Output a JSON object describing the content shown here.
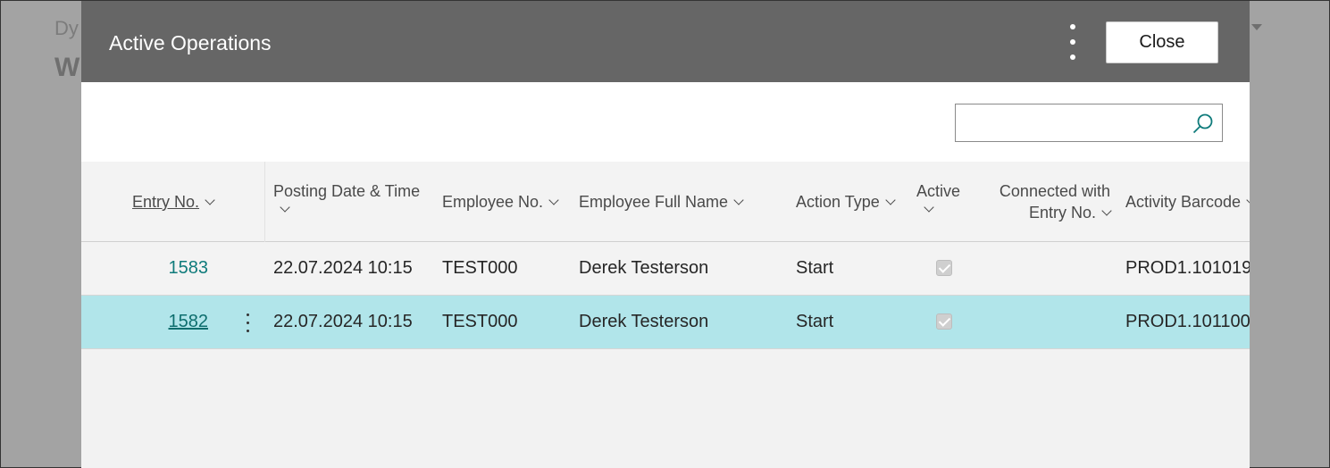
{
  "background": {
    "title_line1": "Dy",
    "title_line2": "W"
  },
  "dialog": {
    "title": "Active Operations",
    "close_label": "Close",
    "search_placeholder": ""
  },
  "columns": {
    "entry_no": "Entry No.",
    "posting_date_time": "Posting Date & Time",
    "employee_no": "Employee No.",
    "employee_full_name": "Employee Full Name",
    "action_type": "Action Type",
    "active": "Active",
    "connected_line1": "Connected with",
    "connected_line2": "Entry No.",
    "activity_barcode": "Activity Barcode"
  },
  "rows": [
    {
      "entry_no": "1583",
      "posting": "22.07.2024 10:15",
      "employee_no": "TEST000",
      "name": "Derek Testerson",
      "action": "Start",
      "active": true,
      "barcode": "PROD1.101019",
      "selected": false
    },
    {
      "entry_no": "1582",
      "posting": "22.07.2024 10:15",
      "employee_no": "TEST000",
      "name": "Derek Testerson",
      "action": "Start",
      "active": true,
      "barcode": "PROD1.101100",
      "selected": true
    }
  ],
  "colors": {
    "header_bg": "#666666",
    "selected_row": "#b1e5ea",
    "link": "#0f7b7b"
  }
}
